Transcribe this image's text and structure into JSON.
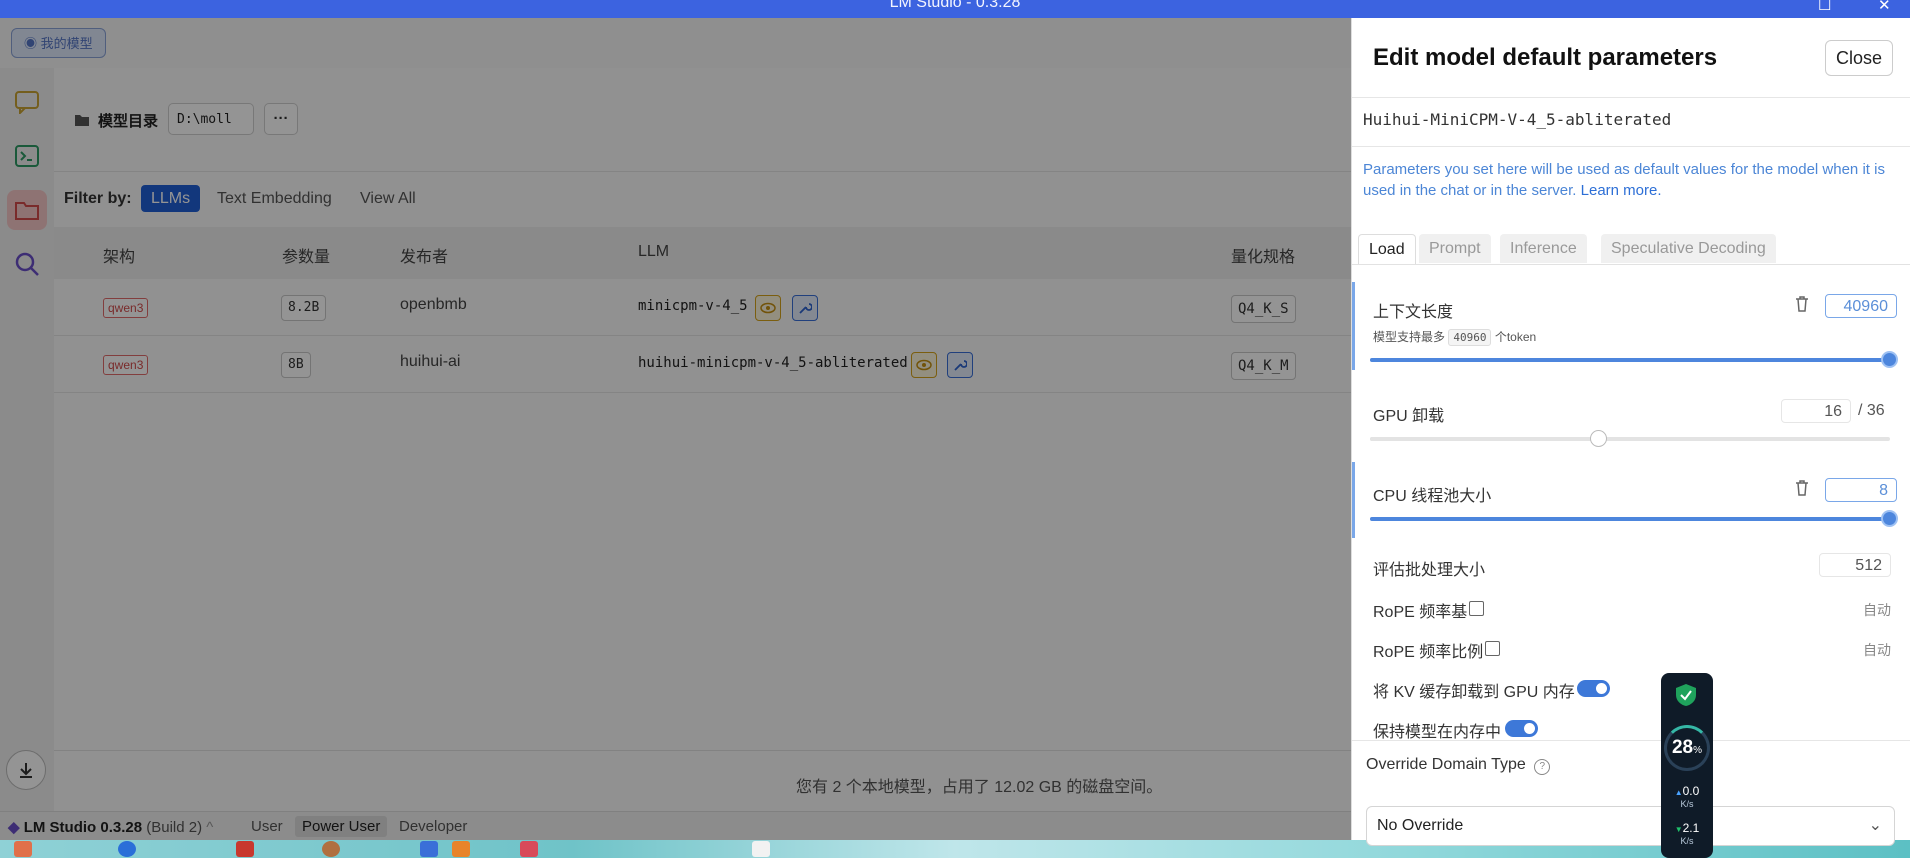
{
  "window": {
    "title": "LM Studio - 0.3.28"
  },
  "topbar": {
    "my_models_label": "我的模型"
  },
  "models_dir": {
    "label": "模型目录",
    "path": "D:\\moll",
    "more": "···"
  },
  "filter": {
    "label": "Filter by:",
    "chips": [
      "LLMs",
      "Text Embedding",
      "View All"
    ],
    "selected": "LLMs"
  },
  "table": {
    "headers": [
      "架构",
      "参数量",
      "发布者",
      "LLM",
      "量化规格"
    ],
    "rows": [
      {
        "arch": "qwen3",
        "params": "8.2B",
        "publisher": "openbmb",
        "llm": "minicpm-v-4_5",
        "quant": "Q4_K_S"
      },
      {
        "arch": "qwen3",
        "params": "8B",
        "publisher": "huihui-ai",
        "llm": "huihui-minicpm-v-4_5-abliterated",
        "quant": "Q4_K_M"
      }
    ]
  },
  "footer": {
    "summary": "您有 2 个本地模型，占用了 12.02 GB 的磁盘空间。"
  },
  "statusbar": {
    "app": "LM Studio 0.3.28",
    "build": "(Build 2)",
    "modes": [
      "User",
      "Power User",
      "Developer"
    ],
    "selected_mode": "Power User"
  },
  "panel": {
    "title": "Edit model default parameters",
    "close_label": "Close",
    "model_name": "Huihui-MiniCPM-V-4_5-abliterated",
    "description": "Parameters you set here will be used as default values for the model when it is used in the chat or in the server.",
    "learn_more": "Learn more.",
    "tabs": [
      "Load",
      "Prompt",
      "Inference",
      "Speculative Decoding"
    ],
    "selected_tab": "Load",
    "context_length": {
      "label": "上下文长度",
      "value": "40960",
      "hint_prefix": "模型支持最多",
      "hint_value": "40960",
      "hint_suffix": "个token",
      "fraction": 1.0
    },
    "gpu_offload": {
      "label": "GPU 卸载",
      "value": "16",
      "max": "/ 36",
      "fraction": 0.44
    },
    "cpu_threads": {
      "label": "CPU 线程池大小",
      "value": "8",
      "fraction": 1.0
    },
    "eval_batch": {
      "label": "评估批处理大小",
      "value": "512"
    },
    "rope_base": {
      "label": "RoPE 频率基",
      "auto": "自动"
    },
    "rope_scale": {
      "label": "RoPE 频率比例",
      "auto": "自动"
    },
    "kv_offload": {
      "label": "将 KV 缓存卸载到 GPU 内存",
      "enabled": true
    },
    "keep_in_memory": {
      "label": "保持模型在内存中",
      "enabled": true
    },
    "override_domain": {
      "label": "Override Domain Type",
      "value": "No Override"
    }
  },
  "widget": {
    "percent": "28",
    "percent_sign": "%",
    "up_rate": "0.0",
    "down_rate": "2.1",
    "unit": "K/s"
  },
  "colors": {
    "accent": "#1f5fd6",
    "titlebar": "#3c63e0",
    "link": "#4c86d6"
  }
}
